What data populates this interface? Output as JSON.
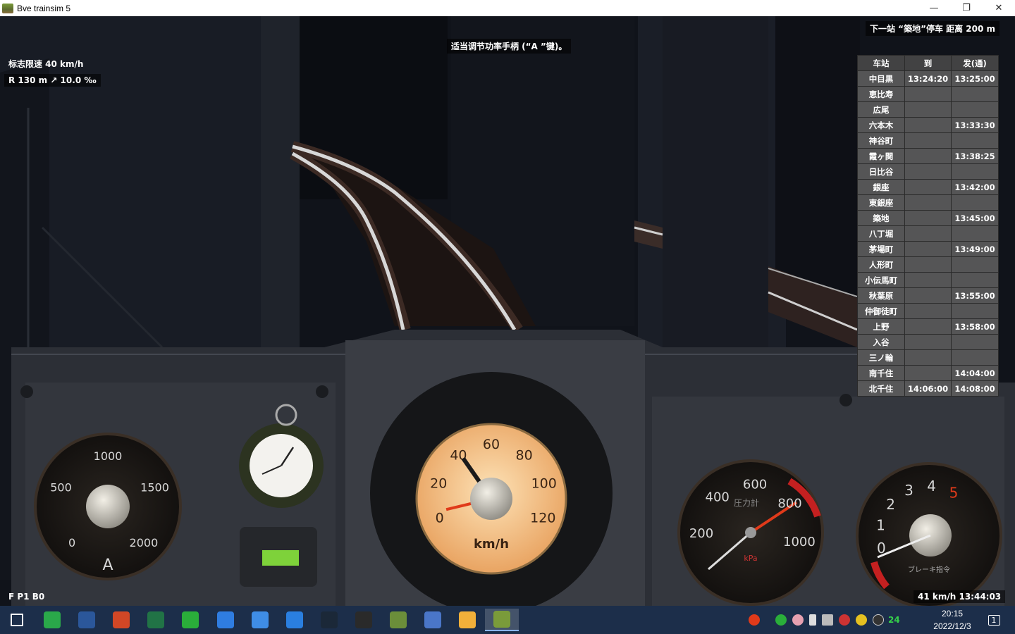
{
  "window": {
    "title": "Bve trainsim 5",
    "minimize": "—",
    "restore": "❐",
    "close": "✕"
  },
  "hud": {
    "next_station": "下一站 “築地”停车 距离 200 m",
    "hint": "适当调节功率手柄 (“A ”键)。",
    "speed_limit": "标志限速 40 km/h",
    "curve_info": "R 130 m  ↗ 10.0 ‰",
    "notch_status": "F  P1  B0",
    "speed_time": "41 km/h  13:44:03"
  },
  "timetable": {
    "headers": [
      "车站",
      "到",
      "发(通)"
    ],
    "rows": [
      [
        "中目黒",
        "13:24:20",
        "13:25:00"
      ],
      [
        "恵比寿",
        "",
        ""
      ],
      [
        "広尾",
        "",
        ""
      ],
      [
        "六本木",
        "",
        "13:33:30"
      ],
      [
        "神谷町",
        "",
        ""
      ],
      [
        "霞ヶ関",
        "",
        "13:38:25"
      ],
      [
        "日比谷",
        "",
        ""
      ],
      [
        "銀座",
        "",
        "13:42:00"
      ],
      [
        "東銀座",
        "",
        ""
      ],
      [
        "築地",
        "",
        "13:45:00"
      ],
      [
        "八丁堀",
        "",
        ""
      ],
      [
        "茅場町",
        "",
        "13:49:00"
      ],
      [
        "人形町",
        "",
        ""
      ],
      [
        "小伝馬町",
        "",
        ""
      ],
      [
        "秋葉原",
        "",
        "13:55:00"
      ],
      [
        "仲御徒町",
        "",
        ""
      ],
      [
        "上野",
        "",
        "13:58:00"
      ],
      [
        "入谷",
        "",
        ""
      ],
      [
        "三ノ輪",
        "",
        ""
      ],
      [
        "南千住",
        "",
        "14:04:00"
      ],
      [
        "北千住",
        "14:06:00",
        "14:08:00"
      ]
    ]
  },
  "gauges": {
    "ammeter": {
      "ticks": [
        "0",
        "500",
        "1000",
        "1500",
        "2000"
      ],
      "unit": "A"
    },
    "speedometer": {
      "ticks": [
        "0",
        "20",
        "40",
        "60",
        "80",
        "100",
        "120"
      ],
      "unit": "km/h",
      "value_kmh": 41
    },
    "pressure": {
      "ticks": [
        "200",
        "400",
        "600",
        "800",
        "1000"
      ],
      "label": "圧力計",
      "unit": "kPa"
    },
    "brake": {
      "ticks": [
        "0",
        "1",
        "2",
        "3",
        "4",
        "5"
      ],
      "label": "ブレーキ指令"
    }
  },
  "taskbar": {
    "apps": [
      "start",
      "browser",
      "word",
      "powerpoint",
      "excel",
      "wechat",
      "feishu",
      "mail",
      "meeting",
      "steam",
      "epic",
      "minecraft",
      "mapping",
      "notes",
      "bve"
    ],
    "tray_number": "24",
    "time": "20:15",
    "date": "2022/12/3",
    "notification_count": "1"
  },
  "colors": {
    "hud_bg": "#000000",
    "table_cell": "#5f5f5f",
    "taskbar": "#1c2e4a",
    "speedo_face": "#f7c98a",
    "needle_red": "#e03a1a"
  }
}
